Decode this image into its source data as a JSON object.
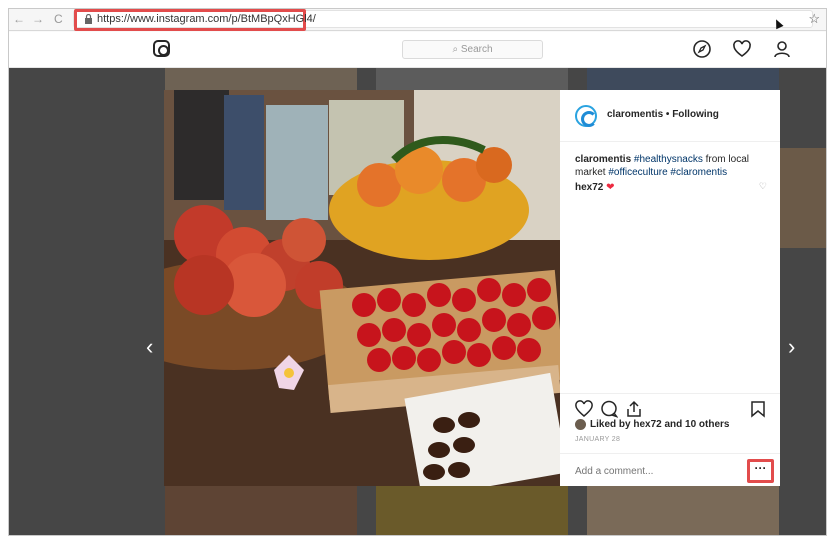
{
  "browser": {
    "back": "←",
    "forward": "→",
    "reload": "C",
    "url": "https://www.instagram.com/p/BtMBpQxHGl4/",
    "bookmark": "☆"
  },
  "instagram": {
    "search_placeholder": "Search",
    "icons": [
      "instagram-logo-icon",
      "compass-icon",
      "heart-icon",
      "profile-icon"
    ]
  },
  "post": {
    "header": "claromentis • Following",
    "caption_user": "claromentis",
    "caption_tag1": "#healthysnacks",
    "caption_text1": " from local market ",
    "caption_tag2": "#officeculture",
    "caption_tag3": "#claromentis",
    "comment_user": "hex72",
    "comment_heart": "❤",
    "liked_by": "Liked by hex72 and 10 others",
    "date": "JANUARY 28",
    "add_comment_placeholder": "Add a comment...",
    "more": "···"
  },
  "nav": {
    "prev": "‹",
    "next": "›"
  },
  "colors": {
    "highlight": "#e24c4c",
    "hashtag": "#003569",
    "heart": "#ed2b40"
  }
}
